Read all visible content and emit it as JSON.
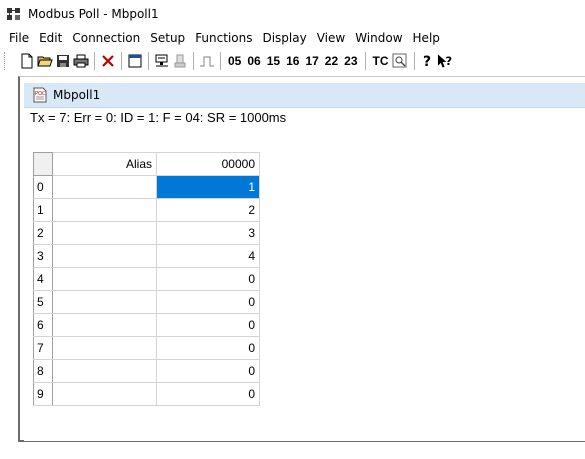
{
  "window": {
    "title": "Modbus Poll - Mbpoll1"
  },
  "menu": {
    "items": [
      "File",
      "Edit",
      "Connection",
      "Setup",
      "Functions",
      "Display",
      "View",
      "Window",
      "Help"
    ]
  },
  "toolbar": {
    "icons": [
      "new-file-icon",
      "open-folder-icon",
      "save-icon",
      "print-icon",
      "delete-x-icon",
      "window-icon",
      "connect-icon",
      "disconnect-icon",
      "pulse-icon",
      "tc-monitor-icon",
      "help-icon",
      "context-help-icon"
    ],
    "function_codes": [
      "05",
      "06",
      "15",
      "16",
      "17",
      "22",
      "23"
    ],
    "tc_label": "TC"
  },
  "child": {
    "title": "Mbpoll1",
    "status": "Tx = 7: Err = 0: ID = 1: F = 04: SR = 1000ms",
    "grid": {
      "headers": {
        "alias": "Alias",
        "value": "00000"
      },
      "rows": [
        {
          "index": "0",
          "alias": "",
          "value": "1",
          "selected": true
        },
        {
          "index": "1",
          "alias": "",
          "value": "2"
        },
        {
          "index": "2",
          "alias": "",
          "value": "3"
        },
        {
          "index": "3",
          "alias": "",
          "value": "4"
        },
        {
          "index": "4",
          "alias": "",
          "value": "0"
        },
        {
          "index": "5",
          "alias": "",
          "value": "0"
        },
        {
          "index": "6",
          "alias": "",
          "value": "0"
        },
        {
          "index": "7",
          "alias": "",
          "value": "0"
        },
        {
          "index": "8",
          "alias": "",
          "value": "0"
        },
        {
          "index": "9",
          "alias": "",
          "value": "0"
        }
      ]
    }
  },
  "colors": {
    "selection": "#0078d7",
    "child_titlebar": "#d9e8f7"
  }
}
